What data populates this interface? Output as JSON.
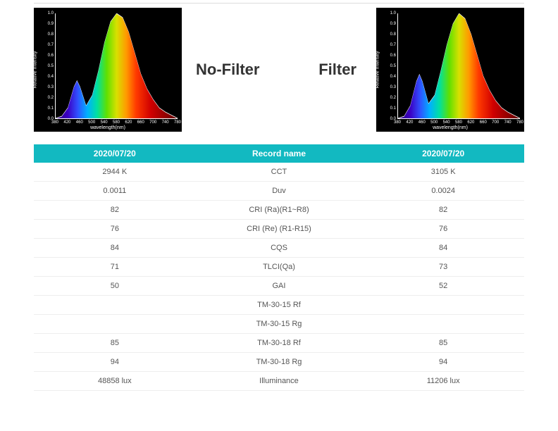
{
  "charts_row": {
    "left_label": "No-Filter",
    "right_label": "Filter",
    "chart_left": {
      "ylabel": "Relative Intensity",
      "xlabel": "wavelength(nm)"
    },
    "chart_right": {
      "ylabel": "Relative Intensity",
      "xlabel": "wavelength(nm)"
    },
    "y_ticks": [
      "0.0",
      "0.1",
      "0.2",
      "0.3",
      "0.4",
      "0.5",
      "0.6",
      "0.7",
      "0.8",
      "0.9",
      "1.0"
    ],
    "x_ticks": [
      "380",
      "420",
      "460",
      "500",
      "540",
      "580",
      "620",
      "660",
      "700",
      "740",
      "780"
    ]
  },
  "table": {
    "headers": [
      "2020/07/20",
      "Record name",
      "2020/07/20"
    ],
    "rows": [
      [
        "2944 K",
        "CCT",
        "3105 K"
      ],
      [
        "0.0011",
        "Duv",
        "0.0024"
      ],
      [
        "82",
        "CRI (Ra)(R1~R8)",
        "82"
      ],
      [
        "76",
        "CRI (Re) (R1-R15)",
        "76"
      ],
      [
        "84",
        "CQS",
        "84"
      ],
      [
        "71",
        "TLCI(Qa)",
        "73"
      ],
      [
        "50",
        "GAI",
        "52"
      ],
      [
        "",
        "TM-30-15 Rf",
        ""
      ],
      [
        "",
        "TM-30-15 Rg",
        ""
      ],
      [
        "85",
        "TM-30-18 Rf",
        "85"
      ],
      [
        "94",
        "TM-30-18 Rg",
        "94"
      ],
      [
        "48858 lux",
        "Illuminance",
        "11206 lux"
      ]
    ]
  },
  "chart_data": [
    {
      "type": "area",
      "title": "No-Filter spectral power distribution",
      "xlabel": "wavelength(nm)",
      "ylabel": "Relative Intensity",
      "xlim": [
        380,
        780
      ],
      "ylim": [
        0,
        1.0
      ],
      "x": [
        380,
        400,
        420,
        440,
        450,
        460,
        480,
        500,
        520,
        540,
        560,
        580,
        600,
        620,
        640,
        660,
        680,
        700,
        720,
        740,
        760,
        780
      ],
      "values": [
        0.0,
        0.02,
        0.1,
        0.3,
        0.36,
        0.3,
        0.12,
        0.22,
        0.45,
        0.72,
        0.92,
        1.0,
        0.96,
        0.82,
        0.62,
        0.42,
        0.28,
        0.18,
        0.1,
        0.06,
        0.03,
        0.0
      ],
      "fill": "visible-spectrum-gradient"
    },
    {
      "type": "area",
      "title": "Filter spectral power distribution",
      "xlabel": "wavelength(nm)",
      "ylabel": "Relative Intensity",
      "xlim": [
        380,
        780
      ],
      "ylim": [
        0,
        1.0
      ],
      "x": [
        380,
        400,
        420,
        440,
        450,
        460,
        480,
        500,
        520,
        540,
        560,
        580,
        600,
        620,
        640,
        660,
        680,
        700,
        720,
        740,
        760,
        780
      ],
      "values": [
        0.0,
        0.02,
        0.12,
        0.35,
        0.42,
        0.35,
        0.14,
        0.22,
        0.45,
        0.7,
        0.9,
        1.0,
        0.95,
        0.8,
        0.6,
        0.4,
        0.27,
        0.17,
        0.1,
        0.06,
        0.03,
        0.0
      ],
      "fill": "visible-spectrum-gradient"
    }
  ]
}
